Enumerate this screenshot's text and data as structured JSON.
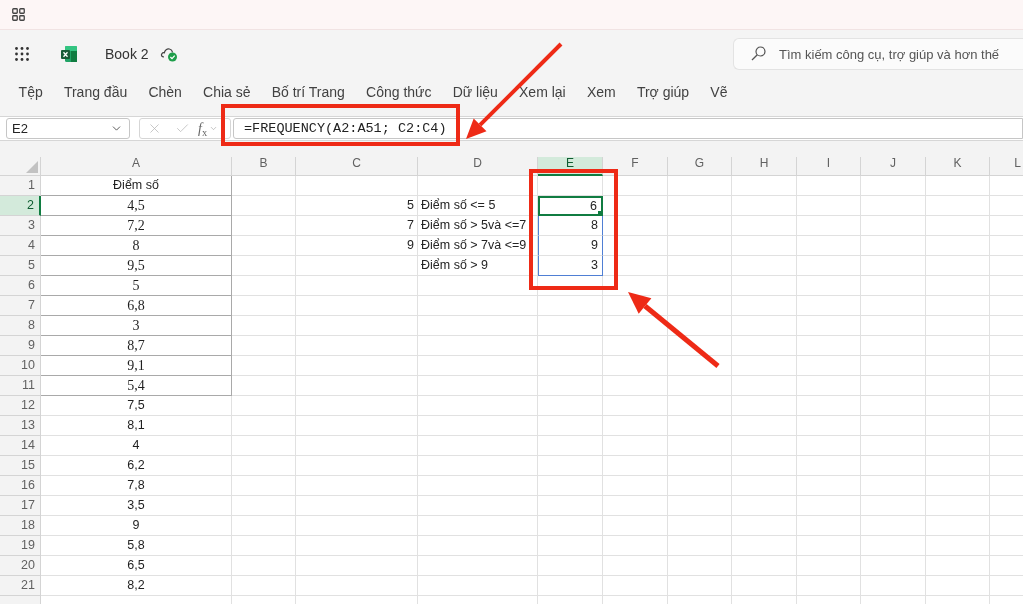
{
  "title_bar": {
    "document_title": "Book 2",
    "search": {
      "placeholder": "Tìm kiếm công cụ, trợ giúp và hơn thế"
    }
  },
  "ribbon_tabs": [
    "Tệp",
    "Trang đầu",
    "Chèn",
    "Chia sẻ",
    "Bố trí Trang",
    "Công thức",
    "Dữ liệu",
    "Xem lại",
    "Xem",
    "Trợ giúp",
    "Vẽ"
  ],
  "formula_bar": {
    "name_box": "E2",
    "function_label": "*f*$_{x}$",
    "formula": "=FREQUENCY(A2:A51; C2:C4)"
  },
  "sheet": {
    "columns": [
      {
        "label": "A",
        "selected": false
      },
      {
        "label": "B",
        "selected": false
      },
      {
        "label": "C",
        "selected": false
      },
      {
        "label": "D",
        "selected": false
      },
      {
        "label": "E",
        "selected": true
      },
      {
        "label": "F",
        "selected": false
      },
      {
        "label": "G",
        "selected": false
      },
      {
        "label": "H",
        "selected": false
      },
      {
        "label": "I",
        "selected": false
      },
      {
        "label": "J",
        "selected": false
      },
      {
        "label": "K",
        "selected": false
      },
      {
        "label": "L",
        "selected": false
      }
    ],
    "rows": [
      {
        "label": "1",
        "selected": false,
        "col_a": {
          "text": "Điểm số",
          "kind": "header"
        }
      },
      {
        "label": "2",
        "selected": true,
        "col_a": {
          "text": "4,5",
          "kind": "table"
        },
        "col_c": "5",
        "col_d": "Điểm số <= 5",
        "col_e": {
          "text": "6",
          "active": true,
          "spill_range": true
        }
      },
      {
        "label": "3",
        "selected": false,
        "col_a": {
          "text": "7,2",
          "kind": "table"
        },
        "col_c": "7",
        "col_d": "Điểm số > 5và <=7",
        "col_e": {
          "text": "8",
          "active": false,
          "spill_range": true
        }
      },
      {
        "label": "4",
        "selected": false,
        "col_a": {
          "text": "8",
          "kind": "table"
        },
        "col_c": "9",
        "col_d": "Điểm số > 7và <=9",
        "col_e": {
          "text": "9",
          "active": false,
          "spill_range": true
        }
      },
      {
        "label": "5",
        "selected": false,
        "col_a": {
          "text": "9,5",
          "kind": "table"
        },
        "col_d": "Điểm số > 9",
        "col_e": {
          "text": "3",
          "active": false,
          "spill_range": true
        }
      },
      {
        "label": "6",
        "selected": false,
        "col_a": {
          "text": "5",
          "kind": "table"
        }
      },
      {
        "label": "7",
        "selected": false,
        "col_a": {
          "text": "6,8",
          "kind": "table"
        }
      },
      {
        "label": "8",
        "selected": false,
        "col_a": {
          "text": "3",
          "kind": "table"
        }
      },
      {
        "label": "9",
        "selected": false,
        "col_a": {
          "text": "8,7",
          "kind": "table"
        }
      },
      {
        "label": "10",
        "selected": false,
        "col_a": {
          "text": "9,1",
          "kind": "table"
        }
      },
      {
        "label": "11",
        "selected": false,
        "col_a": {
          "text": "5,4",
          "kind": "table"
        }
      },
      {
        "label": "12",
        "selected": false,
        "col_a": {
          "text": "7,5",
          "kind": "plain"
        }
      },
      {
        "label": "13",
        "selected": false,
        "col_a": {
          "text": "8,1",
          "kind": "plain"
        }
      },
      {
        "label": "14",
        "selected": false,
        "col_a": {
          "text": "4",
          "kind": "plain"
        }
      },
      {
        "label": "15",
        "selected": false,
        "col_a": {
          "text": "6,2",
          "kind": "plain"
        }
      },
      {
        "label": "16",
        "selected": false,
        "col_a": {
          "text": "7,8",
          "kind": "plain"
        }
      },
      {
        "label": "17",
        "selected": false,
        "col_a": {
          "text": "3,5",
          "kind": "plain"
        }
      },
      {
        "label": "18",
        "selected": false,
        "col_a": {
          "text": "9",
          "kind": "plain"
        }
      },
      {
        "label": "19",
        "selected": false,
        "col_a": {
          "text": "5,8",
          "kind": "plain"
        }
      },
      {
        "label": "20",
        "selected": false,
        "col_a": {
          "text": "6,5",
          "kind": "plain"
        }
      },
      {
        "label": "21",
        "selected": false,
        "col_a": {
          "text": "8,2",
          "kind": "plain"
        }
      }
    ]
  }
}
